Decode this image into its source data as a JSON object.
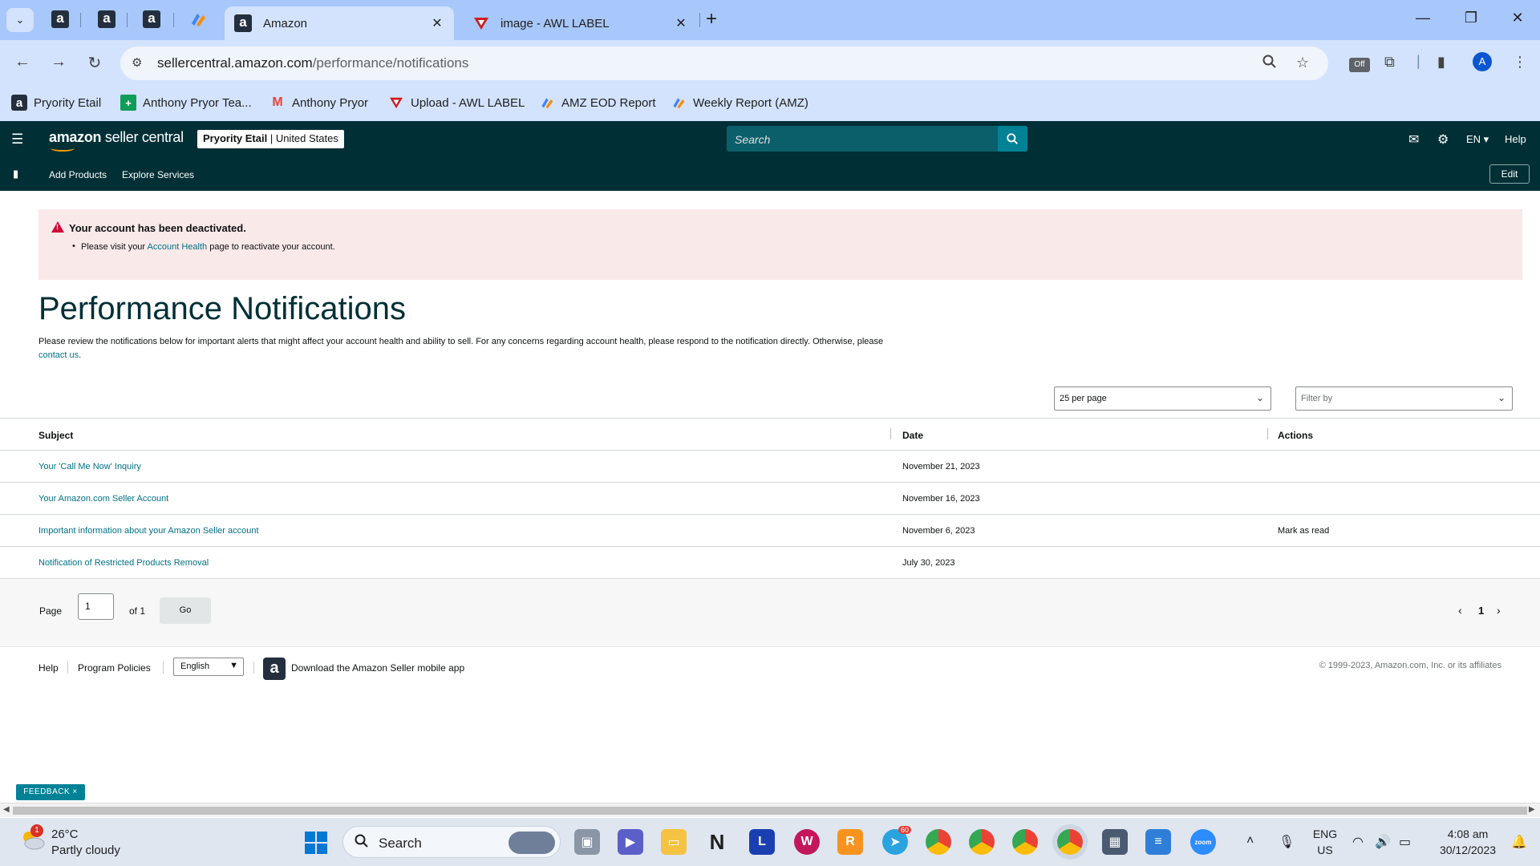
{
  "browser": {
    "tabs": [
      {
        "title": "Amazon",
        "active": true
      },
      {
        "title": "image - AWL LABEL",
        "active": false
      }
    ],
    "url_host": "sellercentral.amazon.com",
    "url_path": "/performance/notifications",
    "bookmarks": [
      {
        "label": "Pryority Etail"
      },
      {
        "label": "Anthony Pryor Tea..."
      },
      {
        "label": "Anthony Pryor"
      },
      {
        "label": "Upload - AWL LABEL"
      },
      {
        "label": "AMZ EOD Report"
      },
      {
        "label": "Weekly Report (AMZ)"
      }
    ],
    "profile_initial": "A",
    "ext_badge": "Off"
  },
  "header": {
    "logo_brand": "amazon",
    "logo_product": "seller central",
    "store_name": "Pryority Etail",
    "store_region": "United States",
    "search_placeholder": "Search",
    "language": "EN",
    "help": "Help"
  },
  "subnav": {
    "links": [
      "Add Products",
      "Explore Services"
    ],
    "edit": "Edit"
  },
  "alert": {
    "title": "Your account has been deactivated.",
    "body_prefix": "Please visit your ",
    "body_link": "Account Health",
    "body_suffix": " page to reactivate your account."
  },
  "page": {
    "title": "Performance Notifications",
    "desc_main": "Please review the notifications below for important alerts that might affect your account health and ability to sell. For any concerns regarding account health, please respond to the notification directly. Otherwise, please",
    "desc_link": "contact us",
    "desc_end": "."
  },
  "controls": {
    "per_page": "25 per page",
    "filter_placeholder": "Filter by"
  },
  "table": {
    "headers": {
      "subject": "Subject",
      "date": "Date",
      "actions": "Actions"
    },
    "rows": [
      {
        "subject": "Your 'Call Me Now' Inquiry",
        "date": "November 21, 2023",
        "action": ""
      },
      {
        "subject": "Your Amazon.com Seller Account",
        "date": "November 16, 2023",
        "action": ""
      },
      {
        "subject": "Important information about your Amazon Seller account",
        "date": "November 6, 2023",
        "action": "Mark as read"
      },
      {
        "subject": "Notification of Restricted Products Removal",
        "date": "July 30, 2023",
        "action": ""
      }
    ]
  },
  "pager": {
    "page_label": "Page",
    "page_value": "1",
    "of_label": "of 1",
    "go": "Go",
    "current": "1"
  },
  "footer": {
    "help": "Help",
    "policies": "Program Policies",
    "language": "English",
    "app_text": "Download the Amazon Seller mobile app",
    "copyright": "© 1999-2023, Amazon.com, Inc. or its affiliates"
  },
  "feedback": "FEEDBACK ×",
  "taskbar": {
    "temp": "26°C",
    "weather": "Partly cloudy",
    "weather_badge": "1",
    "search": "Search",
    "telegram_badge": "60",
    "lang_top": "ENG",
    "lang_bottom": "US",
    "time": "4:08 am",
    "date": "30/12/2023"
  }
}
